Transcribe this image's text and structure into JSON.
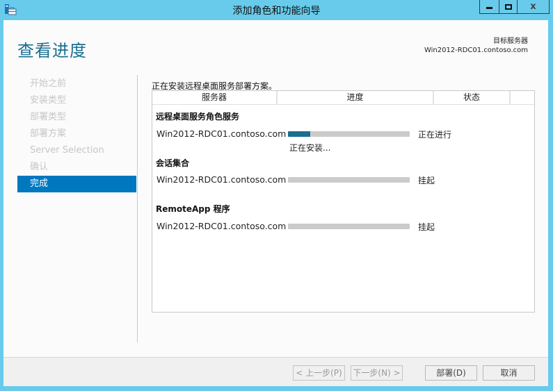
{
  "window": {
    "title": "添加角色和功能向导",
    "app_icon": "server-manager-icon",
    "controls": {
      "minimize": "minimize-icon",
      "maximize": "maximize-icon",
      "close_glyph": "x"
    }
  },
  "header": {
    "page_title": "查看进度",
    "target_label": "目标服务器",
    "target_server": "Win2012-RDC01.contoso.com"
  },
  "nav": {
    "items": [
      {
        "label": "开始之前",
        "active": false
      },
      {
        "label": "安装类型",
        "active": false
      },
      {
        "label": "部署类型",
        "active": false
      },
      {
        "label": "部署方案",
        "active": false
      },
      {
        "label": "Server Selection",
        "active": false
      },
      {
        "label": "确认",
        "active": false
      },
      {
        "label": "完成",
        "active": true
      }
    ]
  },
  "main": {
    "status_text": "正在安装远程桌面服务部署方案。",
    "columns": [
      "服务器",
      "进度",
      "状态",
      ""
    ],
    "groups": [
      {
        "title": "远程桌面服务角色服务",
        "rows": [
          {
            "server": "Win2012-RDC01.contoso.com",
            "progress_percent": 18,
            "status": "正在进行",
            "detail": "正在安装..."
          }
        ]
      },
      {
        "title": "会话集合",
        "rows": [
          {
            "server": "Win2012-RDC01.contoso.com",
            "progress_percent": 0,
            "status": "挂起",
            "detail": ""
          }
        ]
      },
      {
        "title": "RemoteApp 程序",
        "rows": [
          {
            "server": "Win2012-RDC01.contoso.com",
            "progress_percent": 0,
            "status": "挂起",
            "detail": ""
          }
        ]
      }
    ],
    "progress_color": "#1a6f91"
  },
  "footer": {
    "previous": "< 上一步(P)",
    "next": "下一步(N) >",
    "deploy": "部署(D)",
    "cancel": "取消"
  }
}
